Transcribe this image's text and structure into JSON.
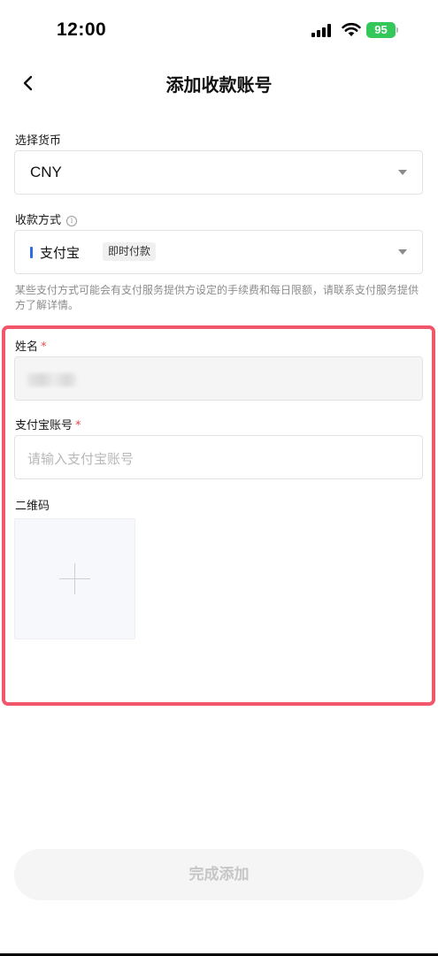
{
  "status_bar": {
    "time": "12:00",
    "battery": "95"
  },
  "header": {
    "title": "添加收款账号"
  },
  "currency": {
    "label": "选择货币",
    "value": "CNY"
  },
  "payment_method": {
    "label": "收款方式",
    "name": "支付宝",
    "tag": "即时付款",
    "notice": "某些支付方式可能会有支付服务提供方设定的手续费和每日限额，请联系支付服务提供方了解详情。",
    "accent_color": "#2e6be6"
  },
  "form": {
    "name_label": "姓名",
    "account_label": "支付宝账号",
    "account_placeholder": "请输入支付宝账号",
    "qr_label": "二维码",
    "required_mark": "*",
    "highlight_color": "#f2566a"
  },
  "footer": {
    "submit_label": "完成添加"
  }
}
